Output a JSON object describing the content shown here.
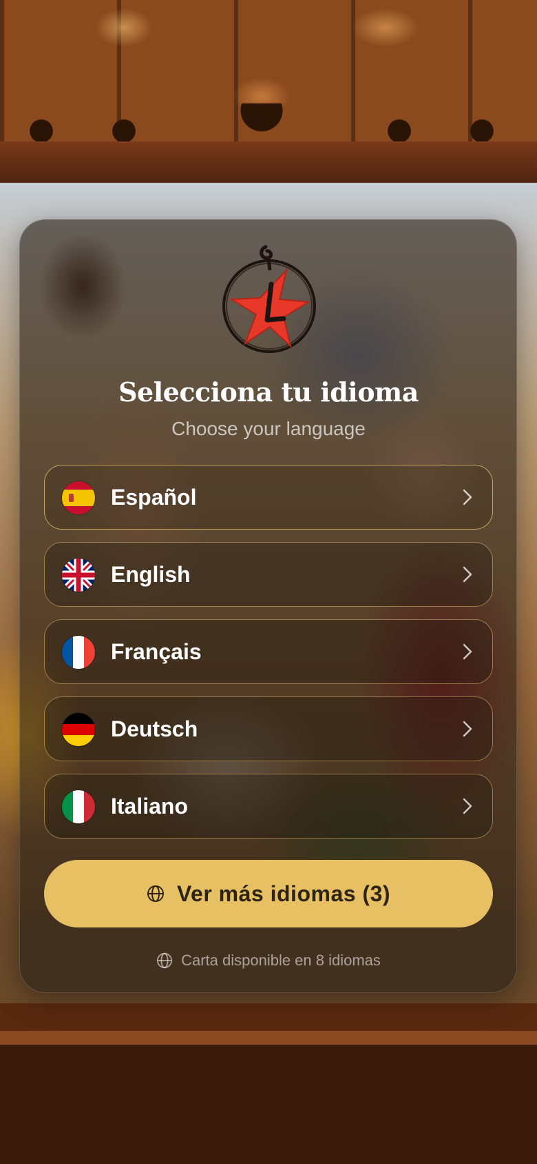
{
  "header": {
    "logo_icon": "red-star-logo-icon",
    "title": "Selecciona tu idioma",
    "subtitle": "Choose your language"
  },
  "languages": [
    {
      "label": "Español",
      "flag": "spain-flag-icon",
      "selected": true
    },
    {
      "label": "English",
      "flag": "uk-flag-icon",
      "selected": false
    },
    {
      "label": "Français",
      "flag": "france-flag-icon",
      "selected": false
    },
    {
      "label": "Deutsch",
      "flag": "germany-flag-icon",
      "selected": false
    },
    {
      "label": "Italiano",
      "flag": "italy-flag-icon",
      "selected": false
    }
  ],
  "more_button": {
    "label": "Ver más idiomas (3)",
    "icon": "globe-icon"
  },
  "footer": {
    "text": "Carta disponible en 8 idiomas",
    "icon": "globe-icon"
  },
  "colors": {
    "accent": "#e8c064",
    "card_border": "#e6be6e",
    "logo_red": "#e8382a"
  }
}
